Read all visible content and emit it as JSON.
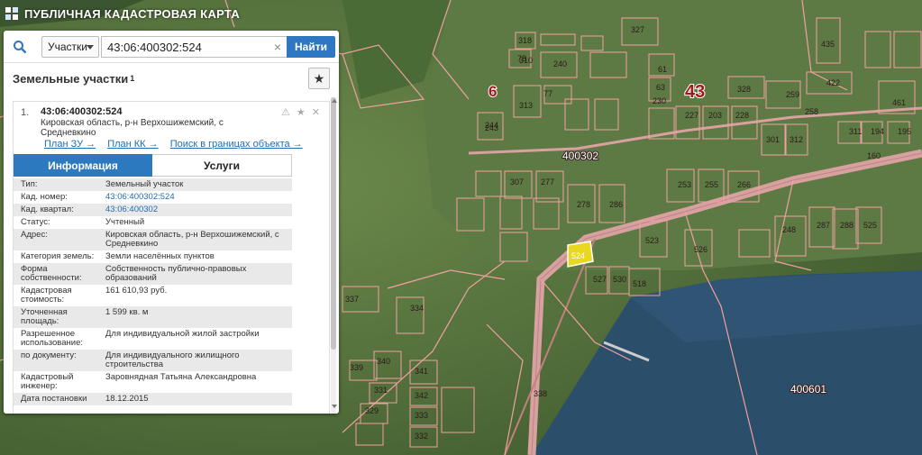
{
  "app": {
    "title": "ПУБЛИЧНАЯ КАДАСТРОВАЯ КАРТА",
    "logo_icon": "cadastral-map-logo-icon"
  },
  "search": {
    "type_selected": "Участки",
    "query": "43:06:400302:524",
    "clear_icon": "×",
    "find_label": "Найти"
  },
  "section": {
    "title": "Земельные участки",
    "count": "1",
    "favorite_icon": "★"
  },
  "result": {
    "number": "1.",
    "cadastral_number": "43:06:400302:524",
    "address": "Кировская область, р-н Верхошижемский, с Средневкино",
    "links": [
      "План ЗУ →",
      "План КК →",
      "Поиск в границах объекта →"
    ],
    "action_icons": "⚠ ★ ✕"
  },
  "tabs": [
    {
      "label": "Информация",
      "active": true
    },
    {
      "label": "Услуги",
      "active": false
    }
  ],
  "info": [
    {
      "label": "Тип:",
      "value": "Земельный участок"
    },
    {
      "label": "Кад. номер:",
      "value": "43:06:400302:524",
      "link": true
    },
    {
      "label": "Кад. квартал:",
      "value": "43:06:400302",
      "link": true
    },
    {
      "label": "Статус:",
      "value": "Учтенный"
    },
    {
      "label": "Адрес:",
      "value": "Кировская область, р-н Верхошижемский, с Средневкино"
    },
    {
      "label": "Категория земель:",
      "value": "Земли населённых пунктов"
    },
    {
      "label": "Форма собственности:",
      "value": "Собственность публично-правовых образований"
    },
    {
      "label": "Кадастровая стоимость:",
      "value": "161 610,93 руб."
    },
    {
      "label": "Уточненная площадь:",
      "value": "1 599 кв. м"
    },
    {
      "label": "Разрешенное использование:",
      "value": "Для индивидуальной жилой застройки"
    },
    {
      "label": "по документу:",
      "value": "Для индивидуального жилищного строительства"
    },
    {
      "label": "Кадастровый инженер:",
      "value": "Заровнядная Татьяна Александровна"
    },
    {
      "label": "Дата постановки",
      "value": "18.12.2015"
    }
  ],
  "map": {
    "big_labels": [
      "43",
      "6"
    ],
    "quarter_labels": [
      "400302",
      "400601"
    ],
    "selected_plot": "524",
    "plot_labels": [
      "327",
      "318",
      "310",
      "240",
      "78",
      "243",
      "313",
      "77",
      "244",
      "61",
      "63",
      "230",
      "328",
      "259",
      "258",
      "422",
      "435",
      "461",
      "160",
      "227",
      "203",
      "228",
      "301",
      "312",
      "311",
      "194",
      "195",
      "307",
      "277",
      "278",
      "286",
      "253",
      "255",
      "266",
      "248",
      "287",
      "288",
      "525",
      "523",
      "526",
      "527",
      "518",
      "530",
      "334",
      "337",
      "338",
      "339",
      "340",
      "341",
      "342",
      "333",
      "332",
      "331",
      "329"
    ],
    "colors": {
      "boundary": "#f0a0a0",
      "selected_fill": "#e8d820",
      "river": "#2b4f6b",
      "road": "#e8b0b0",
      "accent": "#2d79bf"
    }
  }
}
